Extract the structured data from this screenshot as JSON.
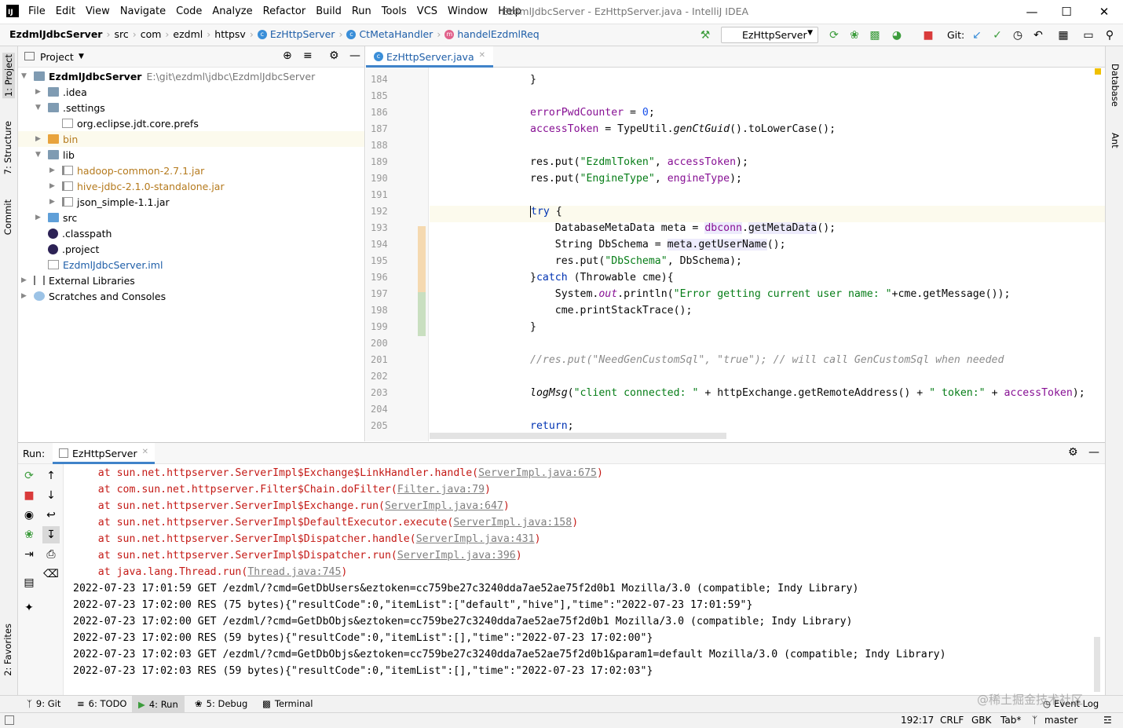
{
  "menubar": {
    "items": [
      "File",
      "Edit",
      "View",
      "Navigate",
      "Code",
      "Analyze",
      "Refactor",
      "Build",
      "Run",
      "Tools",
      "VCS",
      "Window",
      "Help"
    ],
    "title": "EzdmlJdbcServer - EzHttpServer.java - IntelliJ IDEA"
  },
  "navbar": {
    "crumbs": [
      "EzdmlJdbcServer",
      "src",
      "com",
      "ezdml",
      "httpsv",
      "EzHttpServer",
      "CtMetaHandler",
      "handelEzdmlReq"
    ],
    "run_config": "EzHttpServer",
    "git_label": "Git:"
  },
  "left_stripe": {
    "project": "1: Project",
    "structure": "7: Structure",
    "commit": "Commit",
    "favorites": "2: Favorites"
  },
  "right_stripe": {
    "database": "Database",
    "ant": "Ant"
  },
  "project": {
    "header": "Project",
    "root_name": "EzdmlJdbcServer",
    "root_path": "E:\\git\\ezdml\\jdbc\\EzdmlJdbcServer",
    "nodes": [
      ".idea",
      ".settings",
      "org.eclipse.jdt.core.prefs",
      "bin",
      "lib",
      "hadoop-common-2.7.1.jar",
      "hive-jdbc-2.1.0-standalone.jar",
      "json_simple-1.1.jar",
      "src",
      ".classpath",
      ".project",
      "EzdmlJdbcServer.iml",
      "External Libraries",
      "Scratches and Consoles"
    ]
  },
  "editor": {
    "tab": "EzHttpServer.java",
    "line_numbers": [
      "184",
      "185",
      "186",
      "187",
      "188",
      "189",
      "190",
      "191",
      "192",
      "193",
      "194",
      "195",
      "196",
      "197",
      "198",
      "199",
      "200",
      "201",
      "202",
      "203",
      "204",
      "205"
    ]
  },
  "run": {
    "label": "Run:",
    "tab": "EzHttpServer",
    "stack": [
      {
        "at": "sun.net.httpserver.ServerImpl$Exchange$LinkHandler.handle",
        "loc": "ServerImpl.java:675"
      },
      {
        "at": "com.sun.net.httpserver.Filter$Chain.doFilter",
        "loc": "Filter.java:79"
      },
      {
        "at": "sun.net.httpserver.ServerImpl$Exchange.run",
        "loc": "ServerImpl.java:647"
      },
      {
        "at": "sun.net.httpserver.ServerImpl$DefaultExecutor.execute",
        "loc": "ServerImpl.java:158"
      },
      {
        "at": "sun.net.httpserver.ServerImpl$Dispatcher.handle",
        "loc": "ServerImpl.java:431"
      },
      {
        "at": "sun.net.httpserver.ServerImpl$Dispatcher.run",
        "loc": "ServerImpl.java:396"
      },
      {
        "at": "java.lang.Thread.run",
        "loc": "Thread.java:745"
      }
    ],
    "log": [
      "2022-07-23 17:01:59 GET /ezdml/?cmd=GetDbUsers&eztoken=cc759be27c3240dda7ae52ae75f2d0b1 Mozilla/3.0 (compatible; Indy Library)",
      "2022-07-23 17:02:00 RES (75 bytes){\"resultCode\":0,\"itemList\":[\"default\",\"hive\"],\"time\":\"2022-07-23 17:01:59\"}",
      "2022-07-23 17:02:00 GET /ezdml/?cmd=GetDbObjs&eztoken=cc759be27c3240dda7ae52ae75f2d0b1 Mozilla/3.0 (compatible; Indy Library)",
      "2022-07-23 17:02:00 RES (59 bytes){\"resultCode\":0,\"itemList\":[],\"time\":\"2022-07-23 17:02:00\"}",
      "2022-07-23 17:02:03 GET /ezdml/?cmd=GetDbObjs&eztoken=cc759be27c3240dda7ae52ae75f2d0b1&param1=default Mozilla/3.0 (compatible; Indy Library)",
      "2022-07-23 17:02:03 RES (59 bytes){\"resultCode\":0,\"itemList\":[],\"time\":\"2022-07-23 17:02:03\"}"
    ]
  },
  "tooltabs": {
    "git": "9: Git",
    "todo": "6: TODO",
    "run": "4: Run",
    "debug": "5: Debug",
    "terminal": "Terminal",
    "event_log": "Event Log"
  },
  "status": {
    "position": "192:17",
    "line_sep": "CRLF",
    "encoding": "GBK",
    "indent": "Tab*",
    "branch": "master"
  },
  "watermark": "@稀土掘金技术社区"
}
